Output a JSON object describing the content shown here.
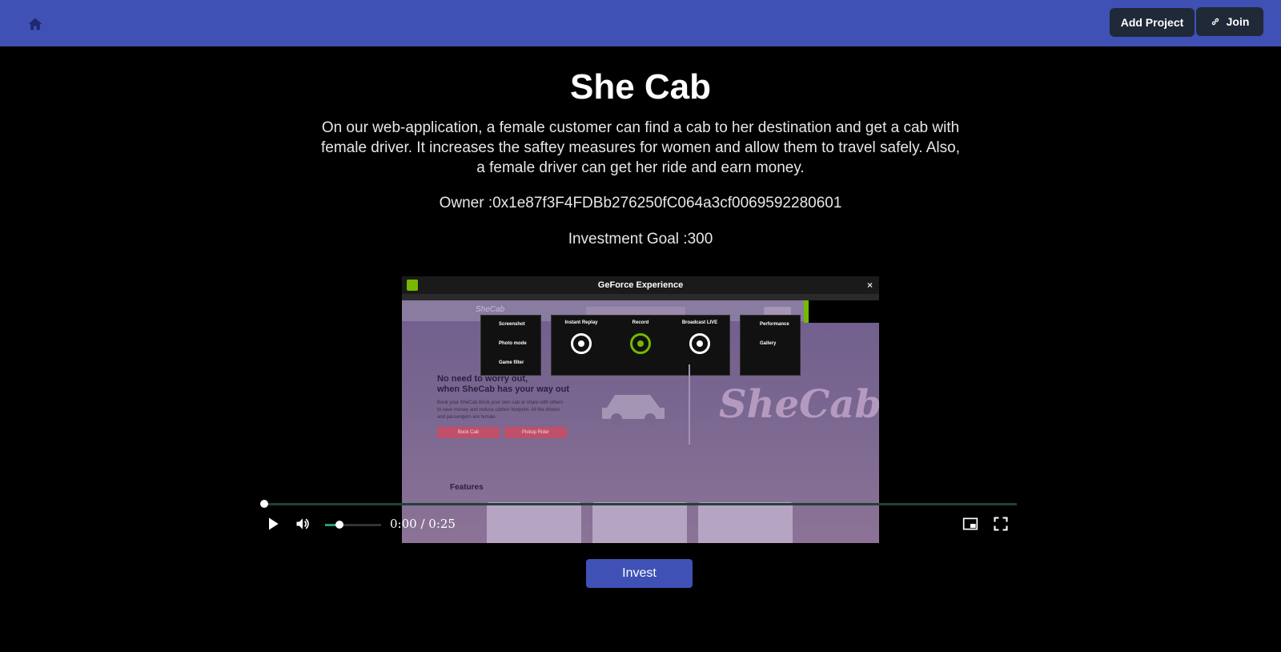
{
  "nav": {
    "home_icon": "home-icon",
    "add_project_label": "Add Project",
    "join_label": "Join",
    "join_icon": "link-icon"
  },
  "project": {
    "title": "She Cab",
    "description": "On our web-application, a female customer can find a cab to her destination and get a cab with female driver. It increases the saftey measures for women and allow them to travel safely. Also, a female driver can get her ride and earn money.",
    "owner": "Owner :0x1e87f3F4FDBb276250fC064a3cf0069592280601",
    "investment_goal": "Investment Goal :300"
  },
  "video": {
    "time": "0:00 / 0:25",
    "progress": 0,
    "volume": 0.25,
    "frame": {
      "window_title": "GeForce Experience",
      "close": "×",
      "overlay_items": [
        "Screenshot",
        "Photo mode",
        "Game filter"
      ],
      "overlay_columns": [
        "Instant Replay",
        "Record",
        "Broadcast LIVE"
      ],
      "overlay_right": [
        "Performance",
        "Gallery"
      ],
      "site_logo": "SheCab",
      "promo_title_1": "No need to worry out,",
      "promo_title_2": "when SheCab has your way out",
      "promo_text": "Book your SheCab Book your own cab or share with others to save money and reduce carbon footprint. All the drivers and passengers are female.",
      "promo_btn_1": "Book Cab",
      "promo_btn_2": "Pickup Rider",
      "brand": "SheCab",
      "features": "Features"
    }
  },
  "actions": {
    "invest_label": "Invest"
  },
  "colors": {
    "header": "#3f51b5",
    "dark_button": "#1f2937",
    "accent_green": "#22a06b"
  }
}
